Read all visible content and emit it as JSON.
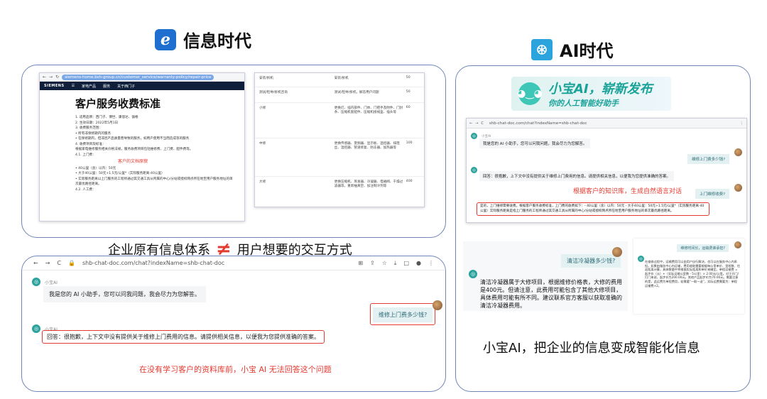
{
  "left_title": "信息时代",
  "right_title": "AI时代",
  "icons": {
    "ie": "ie-browser-icon",
    "ai": "openai-icon",
    "bot": "bot-avatar-icon",
    "user": "user-avatar"
  },
  "colors": {
    "accent_red": "#e53a2f",
    "panel_border": "#6f86b6",
    "bot_teal": "#2ba39c"
  },
  "doc_screen": {
    "url": "siemens-home.bsh-group.cn/customer_service/warranty-policy/repair-price",
    "nav_logo": "SIEMENS",
    "nav_items": [
      "家电产品",
      "服务",
      "关于西门子"
    ],
    "title": "客户服务收费标准",
    "lines": [
      "1. 适用品牌：西门子、博世、康恩达、伽格",
      "2. 生效日期：2022年5月1日",
      "3. 收费服务范围：",
      "• 所有非保修期内的服务",
      "• 在保修期内，但非因产品质量而导致的服务，如用户使用不当而造成等的服务",
      "4. 收费项目及标准：",
      "根据家电维修服务相关价格法规，服务收费项目包括维修费、上门费、配件费等。",
      "4.1. 上门费："
    ],
    "annotation": "客户的文档原貌",
    "lines2": [
      "• 40公里（含）以内：50元",
      "• 大于40公里：50元+1.5元/公里*（实际服务距离-40公里）",
      "• 实际服务距离以上门服务的工程师通过其交通工具从所属的中心/分站或授权网点所在地至用户服务地址的单次最优路径距离。",
      "4.2. 人工费："
    ],
    "table": [
      [
        "安装/拆机",
        "安装/拆机",
        "50"
      ],
      [
        "测试/检导/拆机咨询",
        "测试/检导/拆机，解答用户问题",
        "50"
      ],
      [
        "小修",
        "更换灯、插内部件、门体、门把手及附件、门封条、压缩机套配件、压缩机接线盒、插头等",
        "60"
      ],
      [
        "中修",
        "更换传感器、变频器、显示板、温控器、排阻丝、温控器、管道修复、防冻器、加热器等",
        "100"
      ],
      [
        "大修",
        "更换压缩机、蒸发器、冷凝器、电磁阀、干燥过滤器等，重新抽真空、加注制冷剂等",
        "400"
      ]
    ]
  },
  "caption_mid": {
    "left": "企业原有信息体系",
    "neq": "≠",
    "right": "用户想要的交互方式"
  },
  "chat_left": {
    "url": "shb-chat-doc.com/chat?indexName=shb-chat-doc",
    "bot_name": "小宝AI",
    "greeting": "我是您的 AI 小助手，您可以问我问题，我会尽力为您解答。",
    "question": "维修上门费多少钱?",
    "answer": "回答：很抱歉，上下文中没有提供关于维修上门费用的信息。请提供相关信息，以便我为您提供准确的答案。",
    "annotation": "在没有学习客户的资料库前，小宝 AI 无法回答这个问题"
  },
  "chat_right": {
    "banner_title": "小宝AI，崭新发布",
    "banner_sub": "你的人工智能好助手",
    "url": "shb-chat-doc.com/chat?indexName=shb-chat-doc",
    "bot_name": "小宝AI",
    "greeting": "我是您的 AI 小助手，您可以问我问题，我会尽力为您解答。",
    "question": "维修上门费多少钱?",
    "answer1": "回答：很抱歉，上下文中没有提供关于维修上门费用的信息。请提供相关信息，以便我为您提供准确的答案。",
    "annotation": "根据客户的知识库，生成自然语言对话",
    "question2": "上门维修收费?",
    "answer2": "是的，上门维修需要收费。根据客户服务收费标准，上门费的收费如下：- 40公里（含）以内：50元 - 大于40公里：50元+1.5元/公里*（实际服务距离-40公里）实际服务距离是指上门服务的工程师通过其交通工具从所属的中心/分站或授权网点所在地至用户服务地址的单次最优路径距离。"
  },
  "chat_small_a": {
    "question": "清洁冷凝器多少钱?",
    "answer": "清洁冷凝器属于大修项目，根据维修价格表，大修的费用是400元。但请注意，此费用可能包含了其他大修项目，具体费用可能有所不同。建议联系官方客服以获取准确的清洁冷凝器费用。"
  },
  "chat_small_b": {
    "question": "维修时间长，运输费谁承担?",
    "answer": "在维修过程中，运输费用可以由用户自行解决，也可以在服务中心内承担。如果由服务中心内运输，费用收取需要根据每公里单价、里程数、往返距离计算，具体数量中将根据实际距离和单价来确定。单程运输费 = 起步价（元）+（实际运输公里数 - 5公里）× 2.00元/公里。对于开门/打门来说，起步价为200.00元。其他产品起步价为70.00元。需要注意的是，此运费为单程费用，若需要“一取一送”，实际运费需要为：单程运输费×2。"
  },
  "caption_right": "小宝AI，把企业的信息变成智能化信息"
}
